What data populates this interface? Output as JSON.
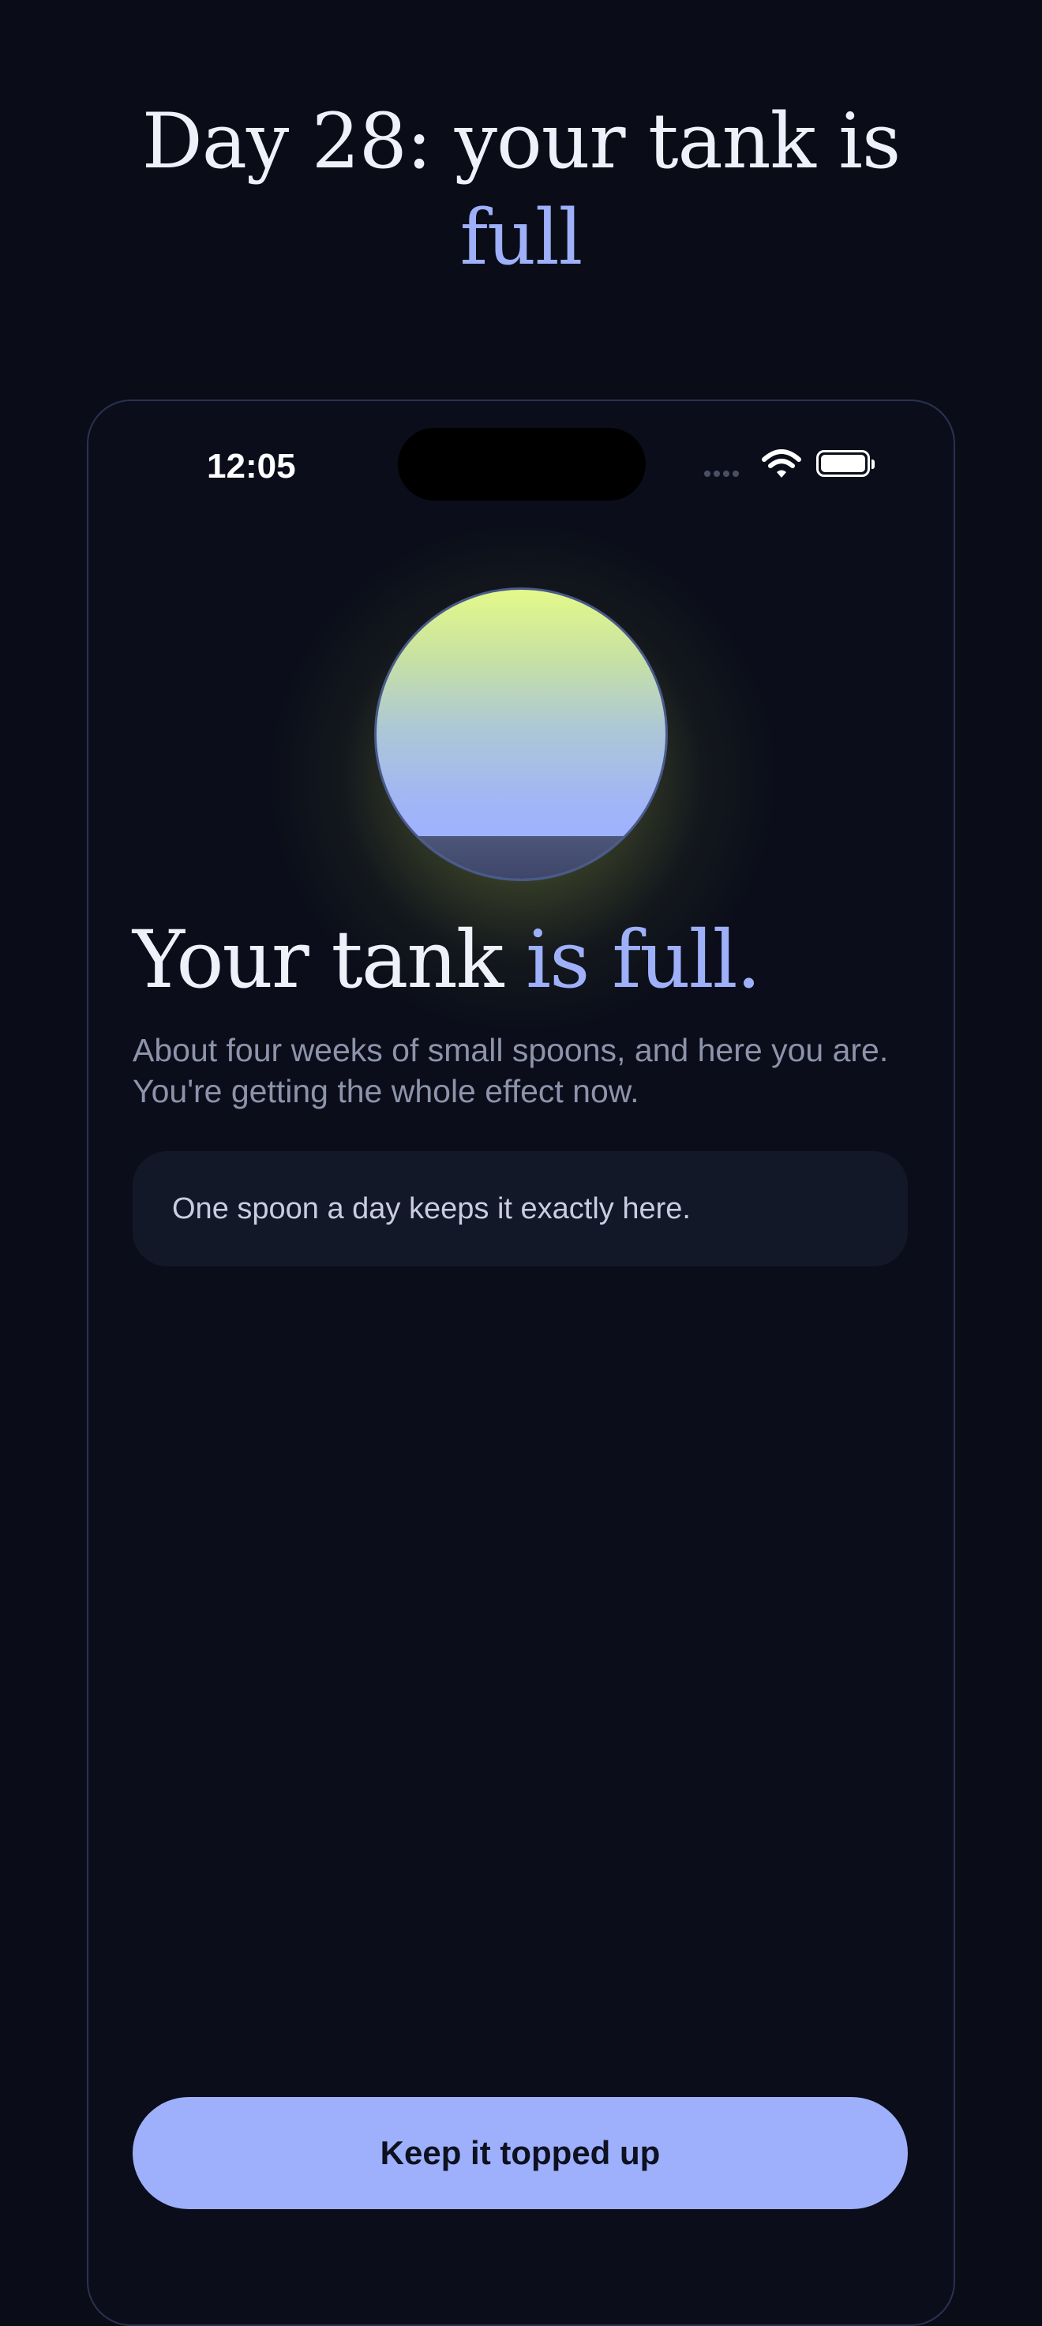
{
  "header": {
    "title_main": "Day 28: your tank is",
    "title_accent": "full"
  },
  "status_bar": {
    "time": "12:05",
    "signal_icon": "cellular-signal-icon",
    "wifi_icon": "wifi-icon",
    "battery_icon": "battery-icon"
  },
  "tank": {
    "icon": "tank-level-circle",
    "fill_level": 1.0
  },
  "content": {
    "title_main": "Your tank ",
    "title_accent": "is full.",
    "subtitle": "About four weeks of small spoons, and here you are. You're getting the whole effect now.",
    "note": "One spoon a day keeps it exactly here."
  },
  "actions": {
    "primary_label": "Keep it topped up"
  },
  "colors": {
    "background": "#0a0d18",
    "accent": "#9eb0f9",
    "button": "#9eb0fb",
    "glow": "#e4f98a"
  }
}
